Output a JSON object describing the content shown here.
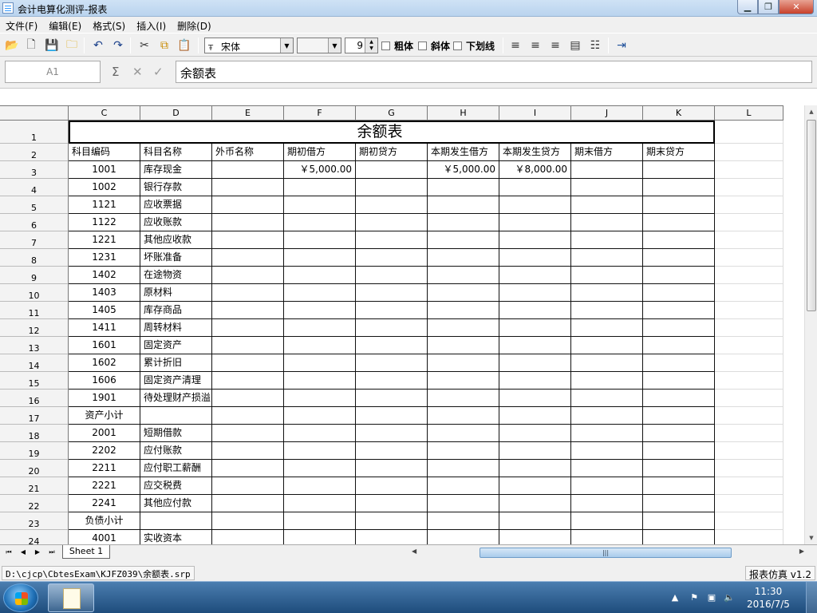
{
  "window": {
    "title": "会计电算化测评-报表"
  },
  "menu": [
    "文件(F)",
    "编辑(E)",
    "格式(S)",
    "插入(I)",
    "删除(D)"
  ],
  "toolbar": {
    "font_name": "宋体",
    "font_size": "9",
    "bold_label": "粗体",
    "italic_label": "斜体",
    "underline_label": "下划线"
  },
  "formula": {
    "cell_ref": "A1",
    "value": "余额表",
    "sum_symbol": "Σ"
  },
  "columns": [
    "C",
    "D",
    "E",
    "F",
    "G",
    "H",
    "I",
    "J",
    "K",
    "L"
  ],
  "sheet": {
    "title": "余额表",
    "headers": [
      "科目编码",
      "科目名称",
      "外币名称",
      "期初借方",
      "期初贷方",
      "本期发生借方",
      "本期发生贷方",
      "期末借方",
      "期末贷方"
    ],
    "rows": [
      {
        "n": "3",
        "code": "1001",
        "name": "库存现金",
        "f": "￥5,000.00",
        "h": "￥5,000.00",
        "i": "￥8,000.00"
      },
      {
        "n": "4",
        "code": "1002",
        "name": "银行存款"
      },
      {
        "n": "5",
        "code": "1121",
        "name": "应收票据"
      },
      {
        "n": "6",
        "code": "1122",
        "name": "应收账款"
      },
      {
        "n": "7",
        "code": "1221",
        "name": "其他应收款"
      },
      {
        "n": "8",
        "code": "1231",
        "name": "坏账准备"
      },
      {
        "n": "9",
        "code": "1402",
        "name": "在途物资"
      },
      {
        "n": "10",
        "code": "1403",
        "name": "原材料"
      },
      {
        "n": "11",
        "code": "1405",
        "name": "库存商品"
      },
      {
        "n": "12",
        "code": "1411",
        "name": "周转材料"
      },
      {
        "n": "13",
        "code": "1601",
        "name": "固定资产"
      },
      {
        "n": "14",
        "code": "1602",
        "name": "累计折旧"
      },
      {
        "n": "15",
        "code": "1606",
        "name": "固定资产清理"
      },
      {
        "n": "16",
        "code": "1901",
        "name": "待处理财产损溢"
      },
      {
        "n": "17",
        "code": "资产小计",
        "name": ""
      },
      {
        "n": "18",
        "code": "2001",
        "name": "短期借款"
      },
      {
        "n": "19",
        "code": "2202",
        "name": "应付账款"
      },
      {
        "n": "20",
        "code": "2211",
        "name": "应付职工薪酬"
      },
      {
        "n": "21",
        "code": "2221",
        "name": "应交税费"
      },
      {
        "n": "22",
        "code": "2241",
        "name": "其他应付款"
      },
      {
        "n": "23",
        "code": "负债小计",
        "name": ""
      },
      {
        "n": "24",
        "code": "4001",
        "name": "实收资本"
      }
    ]
  },
  "sheet_tab": "Sheet 1",
  "status": {
    "path": "D:\\cjcp\\CbtesExam\\KJFZ039\\余额表.srp",
    "version": "报表仿真 v1.2"
  },
  "taskbar": {
    "time": "11:30",
    "date": "2016/7/5"
  }
}
